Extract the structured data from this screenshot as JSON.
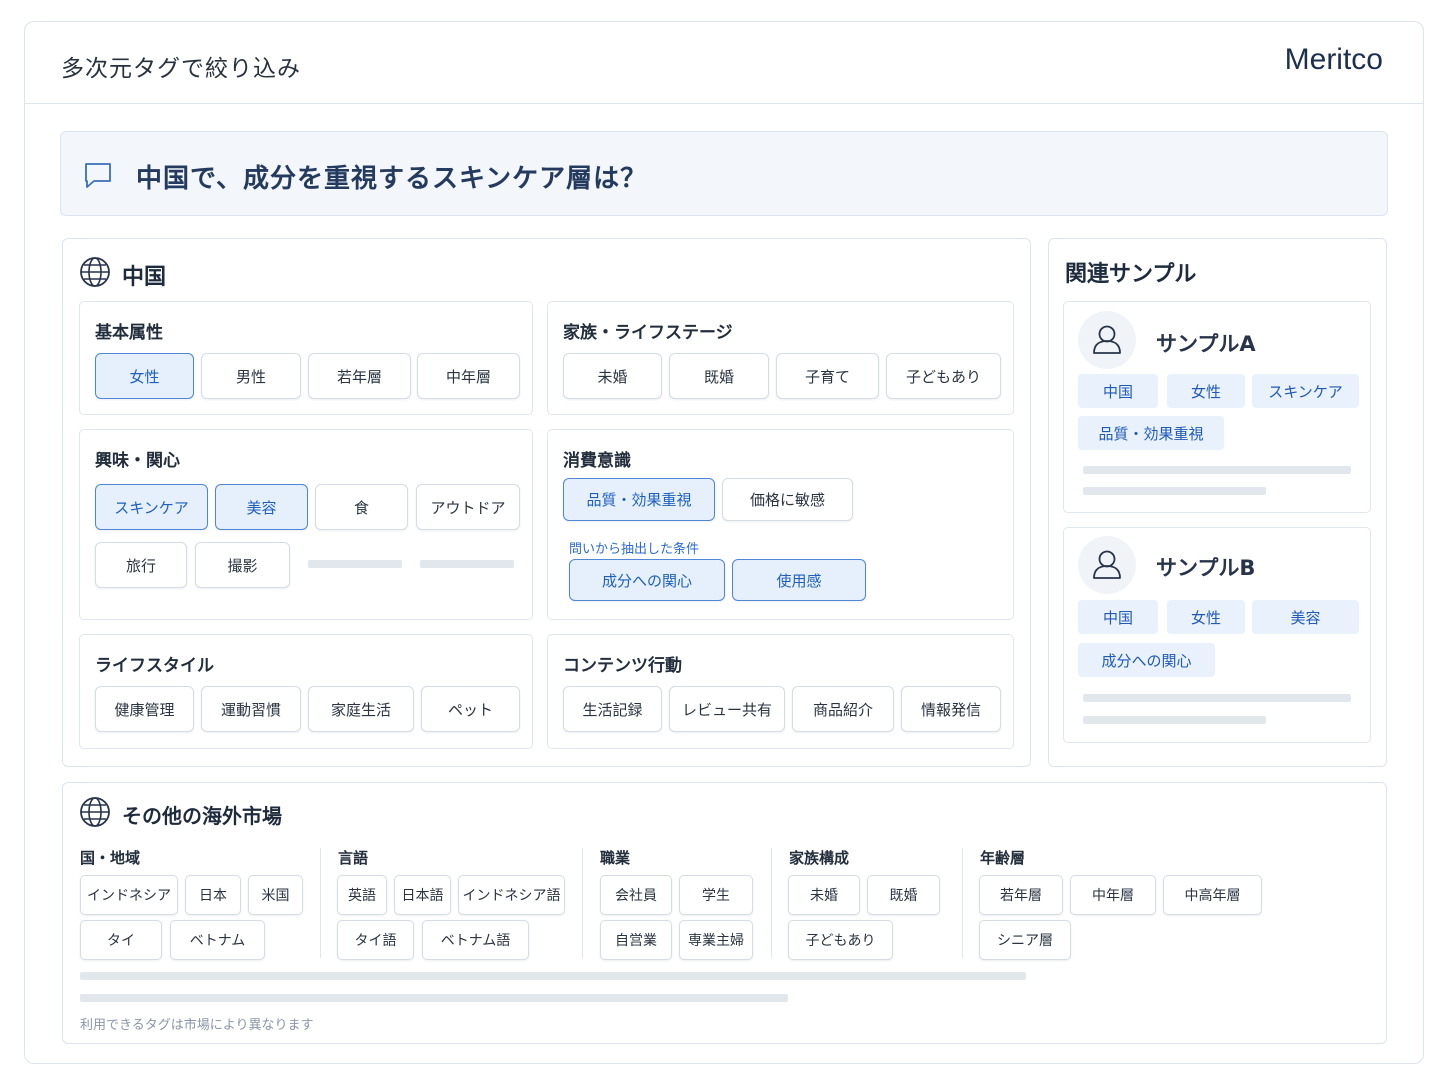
{
  "header": {
    "title": "多次元タグで絞り込み",
    "brand": "Meritco"
  },
  "query": {
    "text": "中国で、成分を重視するスキンケア層は？",
    "icon": "chat-bubble-icon"
  },
  "china": {
    "title": "中国",
    "basic": {
      "title": "基本属性",
      "tags": [
        "女性",
        "男性",
        "若年層",
        "中年層"
      ]
    },
    "family": {
      "title": "家族・ライフステージ",
      "tags": [
        "未婚",
        "既婚",
        "子育て",
        "子どもあり"
      ]
    },
    "interest": {
      "title": "興味・関心",
      "tags": [
        "スキンケア",
        "美容",
        "食",
        "アウトドア",
        "旅行",
        "撮影"
      ]
    },
    "consumption": {
      "title": "消費意識",
      "tags": [
        "品質・効果重視",
        "価格に敏感"
      ],
      "hint": "問いから抽出した条件",
      "extracted": [
        "成分への関心",
        "使用感"
      ]
    },
    "lifestyle": {
      "title": "ライフスタイル",
      "tags": [
        "健康管理",
        "運動習慣",
        "家庭生活",
        "ペット"
      ]
    },
    "content": {
      "title": "コンテンツ行動",
      "tags": [
        "生活記録",
        "レビュー共有",
        "商品紹介",
        "情報発信"
      ]
    }
  },
  "samples": {
    "title": "関連サンプル",
    "a": {
      "name": "サンプルA",
      "tags": [
        "中国",
        "女性",
        "スキンケア",
        "品質・効果重視"
      ]
    },
    "b": {
      "name": "サンプルB",
      "tags": [
        "中国",
        "女性",
        "美容",
        "成分への関心"
      ]
    }
  },
  "overseas": {
    "title": "その他の海外市場",
    "region": {
      "title": "国・地域",
      "tags": [
        "インドネシア",
        "日本",
        "米国",
        "タイ",
        "ベトナム"
      ]
    },
    "language": {
      "title": "言語",
      "tags": [
        "英語",
        "日本語",
        "インドネシア語",
        "タイ語",
        "ベトナム語"
      ]
    },
    "job": {
      "title": "職業",
      "tags": [
        "会社員",
        "学生",
        "自営業",
        "専業主婦"
      ]
    },
    "family": {
      "title": "家族構成",
      "tags": [
        "未婚",
        "既婚",
        "子どもあり"
      ]
    },
    "age": {
      "title": "年齢層",
      "tags": [
        "若年層",
        "中年層",
        "中高年層",
        "シニア層"
      ]
    },
    "footnote": "利用できるタグは市場により異なります"
  },
  "colors": {
    "accent": "#2b6ad1",
    "selected_bg": "#e6f0fd",
    "panel_bg": "#f3f7fc"
  }
}
